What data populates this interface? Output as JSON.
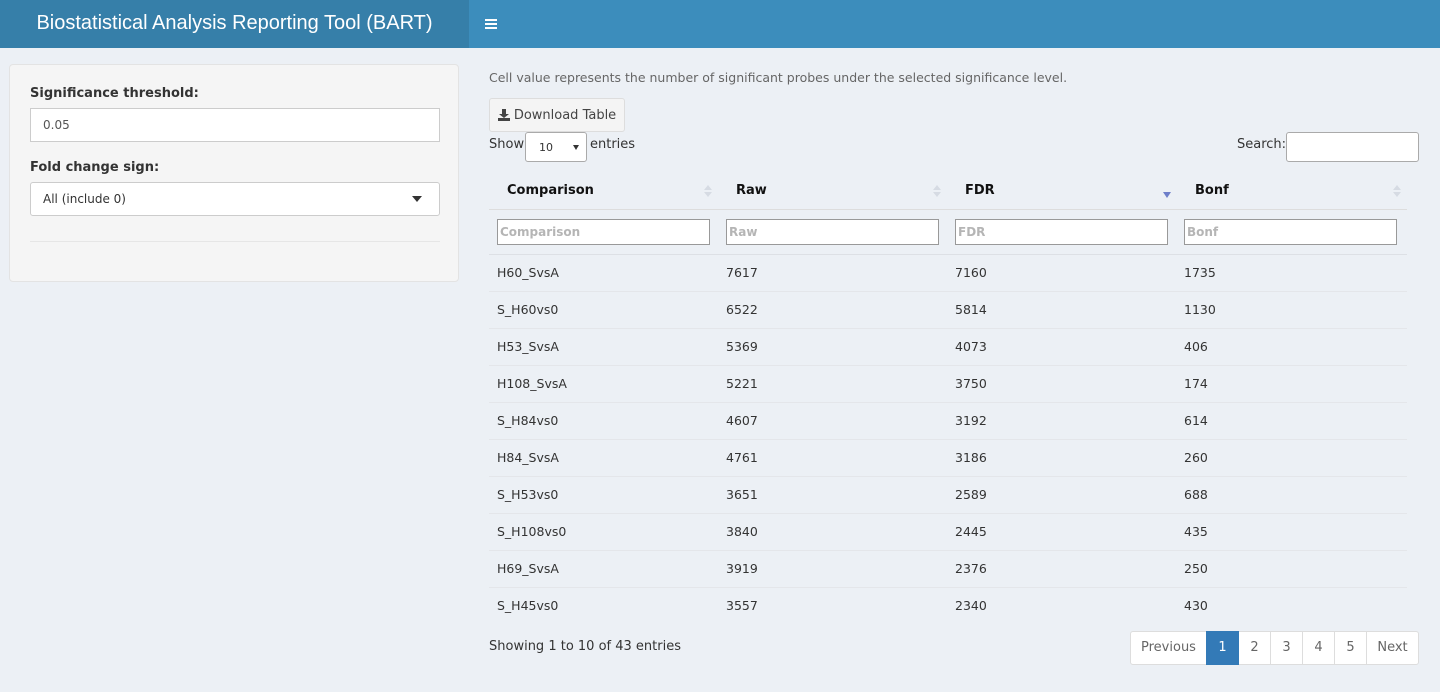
{
  "header": {
    "title": "Biostatistical Analysis Reporting Tool (BART)",
    "menu_icon": "hamburger-icon"
  },
  "sidebar": {
    "threshold_label": "Significance threshold:",
    "threshold_value": "0.05",
    "fold_change_label": "Fold change sign:",
    "fold_change_value": "All (include 0)"
  },
  "main": {
    "info_text": "Cell value represents the number of significant probes under the selected significance level.",
    "download_label": "Download Table",
    "show_label": "Show",
    "entries_value": "10",
    "entries_label": "entries",
    "search_label": "Search:",
    "search_value": ""
  },
  "table": {
    "columns": [
      "Comparison",
      "Raw",
      "FDR",
      "Bonf"
    ],
    "sort": {
      "column": "FDR",
      "direction": "descending"
    },
    "filter_placeholders": [
      "Comparison",
      "Raw",
      "FDR",
      "Bonf"
    ],
    "rows": [
      [
        "H60_SvsA",
        "7617",
        "7160",
        "1735"
      ],
      [
        "S_H60vs0",
        "6522",
        "5814",
        "1130"
      ],
      [
        "H53_SvsA",
        "5369",
        "4073",
        "406"
      ],
      [
        "H108_SvsA",
        "5221",
        "3750",
        "174"
      ],
      [
        "S_H84vs0",
        "4607",
        "3192",
        "614"
      ],
      [
        "H84_SvsA",
        "4761",
        "3186",
        "260"
      ],
      [
        "S_H53vs0",
        "3651",
        "2589",
        "688"
      ],
      [
        "S_H108vs0",
        "3840",
        "2445",
        "435"
      ],
      [
        "H69_SvsA",
        "3919",
        "2376",
        "250"
      ],
      [
        "S_H45vs0",
        "3557",
        "2340",
        "430"
      ]
    ]
  },
  "footer": {
    "showing_text": "Showing 1 to 10 of 43 entries",
    "pagination": {
      "previous": "Previous",
      "pages": [
        "1",
        "2",
        "3",
        "4",
        "5"
      ],
      "active_page": "1",
      "next": "Next"
    }
  },
  "colors": {
    "header_bg": "#3c8dbc",
    "logo_bg": "#367fa9",
    "page_bg": "#ecf0f5",
    "active_page": "#337ab7"
  }
}
